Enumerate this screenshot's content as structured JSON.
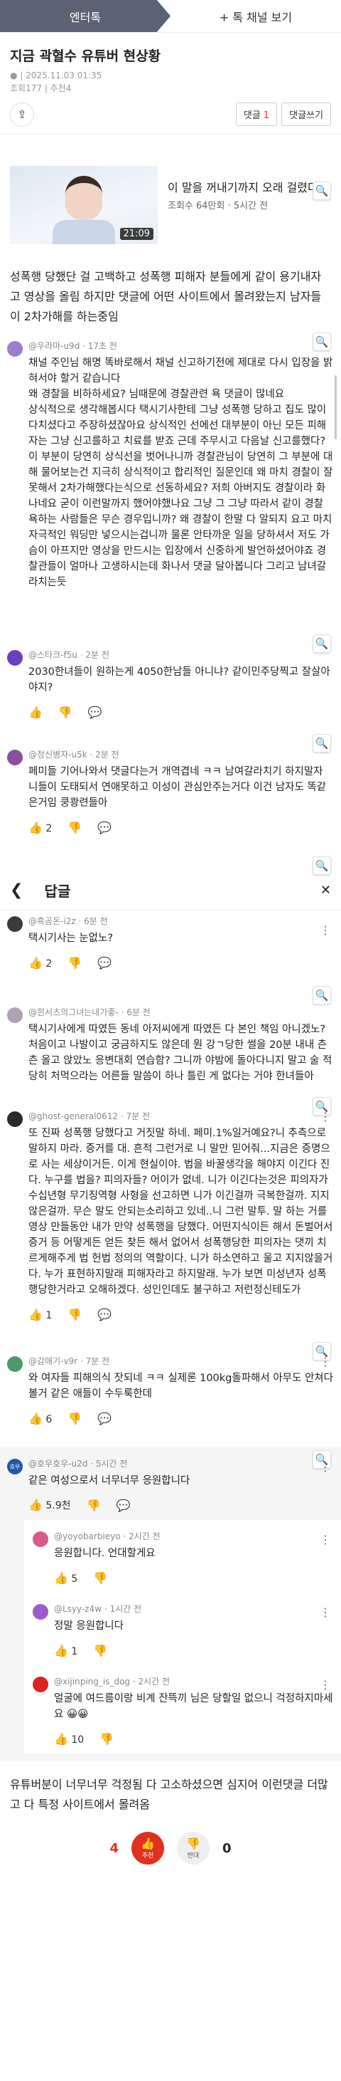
{
  "nav": {
    "tab_active": "엔터톡",
    "tab_add": "+ 톡 채널 보기"
  },
  "post": {
    "title": "지금 곽혈수 유튜버 현상황",
    "date": "| 2025.11.03 01:35",
    "views": "조회177",
    "recommends": "추천4"
  },
  "actions": {
    "comment_label": "댓글",
    "comment_count": "1",
    "write_label": "댓글쓰기"
  },
  "video": {
    "title": "이 말을 꺼내기까지 오래 걸렸다",
    "sub": "조회수 64만회 · 5시간 전",
    "duration": "21:09"
  },
  "body": "성폭행 당했단 걸 고백하고 성폭행 피해자 분들에게 같이 용기내자고 영상을 올림 하지만 댓글에 어떤 사이트에서 몰려왔는지 남자들이 2차가해를 하는중임",
  "comments": [
    {
      "user": "@우라마-u9d",
      "time": "· 17초 전",
      "text": "채널 주인님 해명 똑바로해서 채널 신고하기전에 제대로 다시 입장을 밝혀서야 할거 같습니다\n왜 경찰을 비하하세요? 님때문에 경찰관련 욕 댓글이 많네요\n상식적으로 생각해봅시다 택시기사한테 그냥 성폭행 당하고 집도 많이 다치셨다고 주장하셨잖아요 상식적인 선에선 대부분이 아닌 모든 피해자는 그냥 신고를하고 치료를 받죠 근데 주무시고 다음날 신고를했다?\n이 부분이 당연히 상식선을 벗어나니까 경찰관님이 당연히 그 부분에 대해 물어보는건 지극히 상식적이고 합리적인 질문인데 왜 마치 경찰이 잘못해서 2차가해했다는식으로 선동하세요? 저희 아버지도 경찰이라 화나네요 굳이 이런말까지 했어야했나요 그냥 그 그냥 따라서 같이 경찰 욕하는 사람들은 무슨 경우입니까? 왜 경찰이 한말 다 알되지 요고 마치 자극적인 워딩만 넣으시는겁니까 물론 안타까운 일을 당하셔서 저도 가슴이 아프지만 영상을 만드시는 입장에서 신중하게 발언하셨어야죠 경찰관들이 얼마나 고생하시는데 화나서 댓글 달아봅니다 그리고 남녀갈라치는듯"
    },
    {
      "user": "@스타크-f5u",
      "time": "· 2분 전",
      "text": "2030한녀들이 원하는게 4050한남들 아니냐? 같이민주당찍고 잘살아야지?"
    },
    {
      "user": "@정신병자-u5k",
      "time": "· 2분 전",
      "text": "페미들 기어나와서 댓글다는거 개역겹네 ㅋㅋ 남여갈라치기 하지말자 니들이 도태되서 연애못하고 이성이 관심안주는거다 이건 남자도 똑같은거임 쿵쾅련들아",
      "likes": "2"
    }
  ],
  "reply_section": {
    "title": "답글"
  },
  "replies": [
    {
      "user": "@흑곰돈-i2z",
      "time": "· 6분 전",
      "text": "택시기사는 눈없노?",
      "likes": "2"
    },
    {
      "user": "@힌서츠의그녀는내가좋-",
      "time": "· 6분 전",
      "text": "택시기사에게 따였든 동네 아저씨에게 따였든 다 본인 책임 아니겠노? 처음이고 나발이고 궁금하지도 않은데 뭔 강ㄱ당한 썰을 20분 내내 츤츤 올고 앉았노 응변대회 연습함? 그니까 야밤에 돌아다니지 말고 술 적당히 처먹으라는 어른들 말씀이 하나 틀린 게 없다는 거야 한녀들아"
    },
    {
      "user": "@ghost-general0612",
      "time": "· 7분 전",
      "text": "또 진짜 성폭행 당했다고 거짓말 하네. 페미.1%일거예요?니 추측으로 말하지 마라. 증거를 대. 흔적 그런거로 니 말만 믿어줘...지금은 증명으로 사는 세상이거든. 이게 현실이야. 법을 바꿀생각을 해야지 이긴다 진다. 누구를 법을? 피의자들? 어이가 없네. 니가 이긴다는것은 피의자가 수십년형 무기징역형 사형을 선고하면 니가 이긴걸까 극복한걸까. 지지 않은걸까. 무슨 말도 안되는소리하고 있네..니 그런 말투. 말 하는 거를 영상 만들동안 내가 만약 성폭행을 당했다. 어떤지식이든 해서 돈벌어서 증거 등 어떻게든 얻든 찾든 해서 없어서 성폭행당한 피의자는 댓끼 치르게해주게 법 헌법 정의의 역할이다. 니가 하소연하고 울고 지지않을거다. 누가 표현하지말래 피해자라고 하지말래. 누가 보면 미성년자 성폭행당한거라고 오해하겠다. 성인인데도 불구하고 저런정신테도가",
      "likes": "1"
    },
    {
      "user": "@감매기-v9r",
      "time": "· 7분 전",
      "text": "와 여자들 피해의식 잣되네 ㅋㅋ 실제론 100kg돌파해서 아무도 안쳐다볼거 같은 애들이 수두룩한데",
      "likes": "6"
    },
    {
      "user": "@호우호우-u2d",
      "time": "· 5시간 전",
      "text": "같은 여성으로서 너무너무 응원합니다",
      "likes": "5.9천"
    }
  ],
  "nested": [
    {
      "user": "@yoyobarbieyo",
      "time": "· 2시간 전",
      "text": "응원합니다. 언대할게요",
      "likes": "5"
    },
    {
      "user": "@Lsyy-z4w",
      "time": "· 1시간 전",
      "text": "정말 응원합니다",
      "likes": "1"
    },
    {
      "user": "@xijinping_is_dog",
      "time": "· 2시간 전",
      "text": "얼굴에 여드름이랑 비계 잔뜩끼 님은 당할일 없으니 걱정하지마세요",
      "emoji": "😀😀",
      "likes": "10"
    }
  ],
  "closing": "유튜버분이 너무너무 걱정됨 다 고소하셨으면 심지어 이런댓글 더많고 다 특정 사이트에서 몰려옴",
  "votes": {
    "up": "4",
    "down": "0",
    "up_label": "추천",
    "down_label": "반대"
  },
  "colors": {
    "accent": "#e0301e",
    "nav": "#5b6276"
  }
}
